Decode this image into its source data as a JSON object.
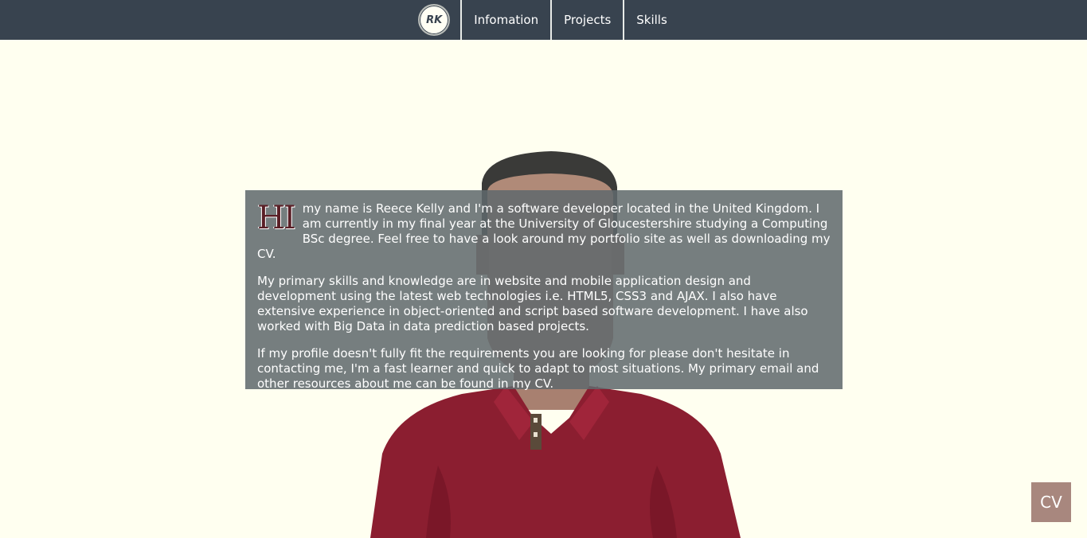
{
  "nav": {
    "logo_text": "RK",
    "items": [
      {
        "label": "Infomation"
      },
      {
        "label": "Projects"
      },
      {
        "label": "Skills"
      }
    ]
  },
  "about": {
    "dropcap": "HI",
    "paragraphs": [
      "my name is Reece Kelly and I'm a software developer located in the United Kingdom. I am currently in my final year at the University of Gloucestershire studying a Computing BSc degree. Feel free to have a look around my portfolio site as well as downloading my CV.",
      "My primary skills and knowledge are in website and mobile application design and development using the latest web technologies i.e. HTML5, CSS3 and AJAX. I also have extensive experience in object-oriented and script based software development. I have also worked with Big Data in data prediction based projects.",
      "If my profile doesn't fully fit the requirements you are looking for please don't hesitate in contacting me, I'm a fast learner and quick to adapt to most situations. My primary email and other resources about me can be found in my CV."
    ]
  },
  "cv_button": {
    "label": "CV"
  },
  "colors": {
    "nav_bg": "#38434f",
    "page_bg": "#fffff0",
    "shirt": "#8b1e30",
    "cv_bg": "#a8877e"
  }
}
